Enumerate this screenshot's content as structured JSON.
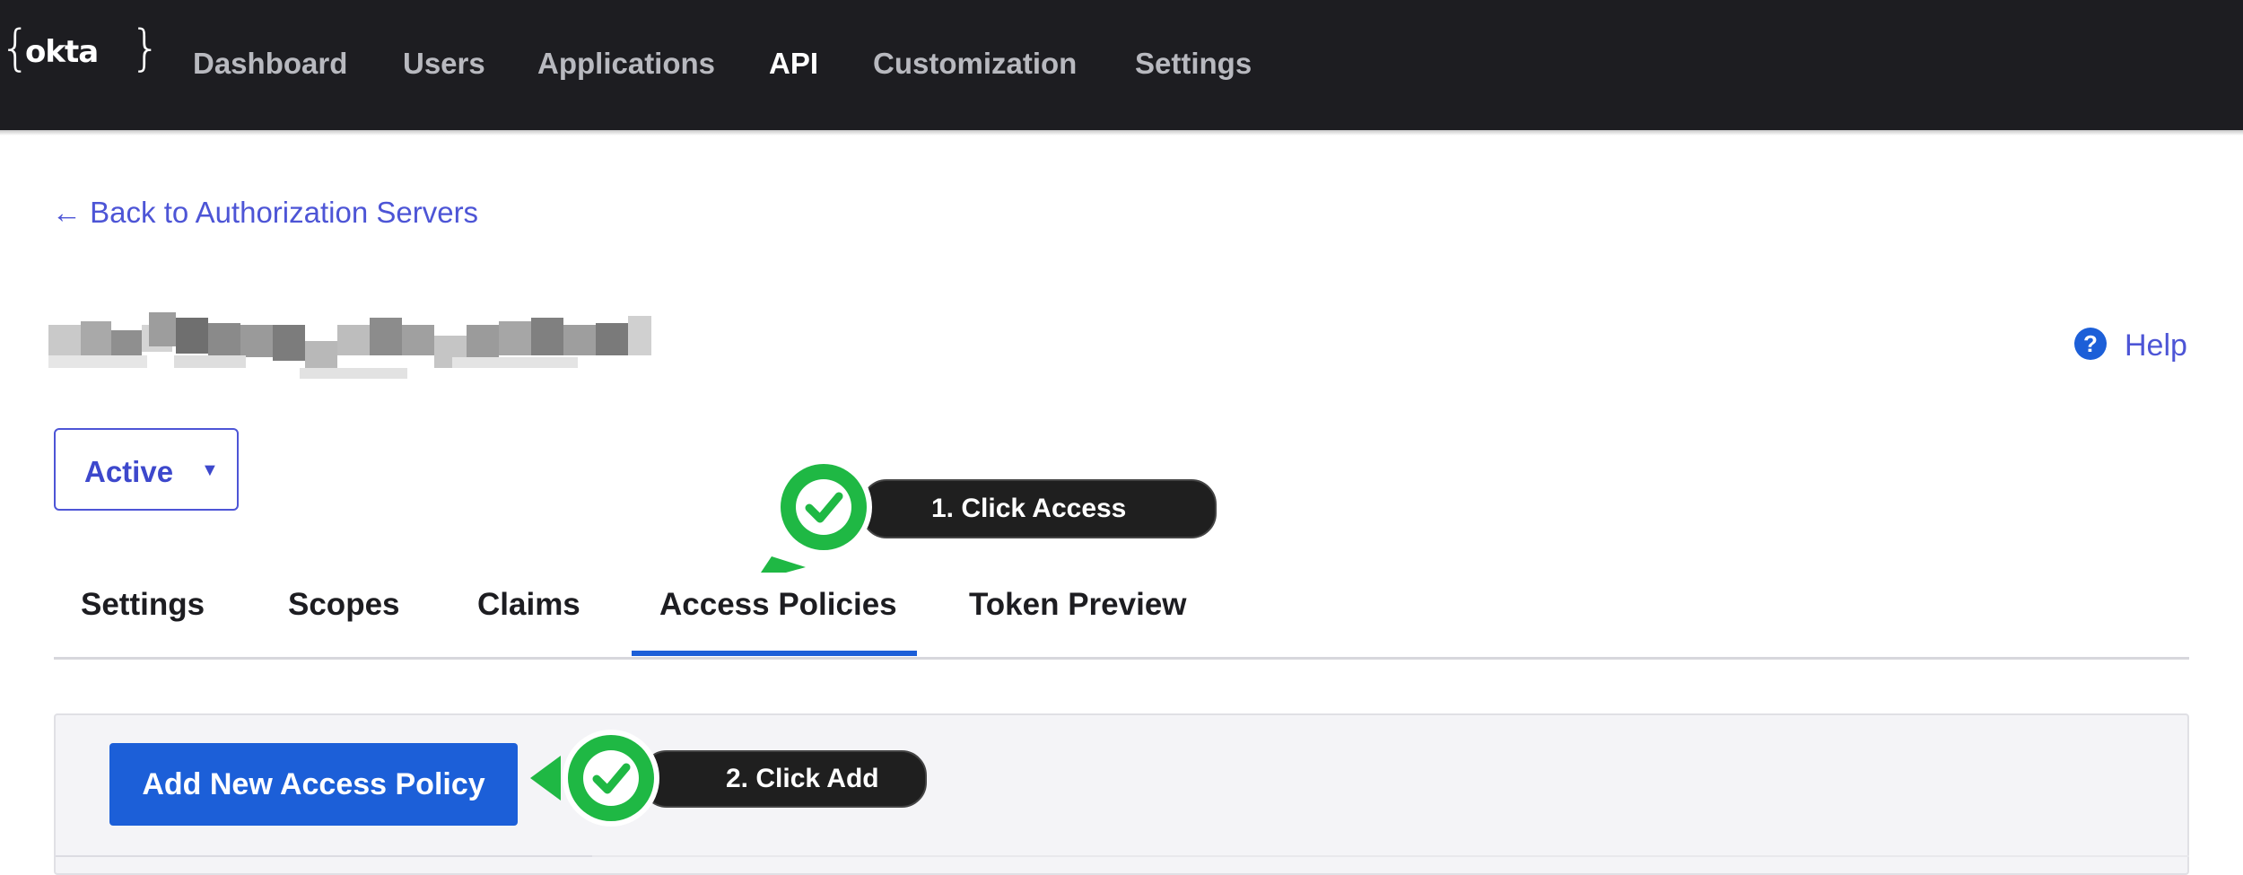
{
  "nav": {
    "logo": "okta",
    "items": [
      "Dashboard",
      "Users",
      "Applications",
      "API",
      "Customization",
      "Settings"
    ],
    "active": "API"
  },
  "back_link": "← Back to Authorization Servers",
  "help": "Help",
  "status": {
    "value": "Active"
  },
  "tabs": [
    "Settings",
    "Scopes",
    "Claims",
    "Access Policies",
    "Token Preview"
  ],
  "active_tab": "Access Policies",
  "add_button": "Add New Access Policy",
  "callouts": [
    "1. Click Access",
    "2. Click Add"
  ],
  "colors": {
    "nav_bg": "#1d1d21",
    "accent": "#1c5fd8",
    "link": "#4d55d6",
    "callout_green": "#1fb844"
  }
}
